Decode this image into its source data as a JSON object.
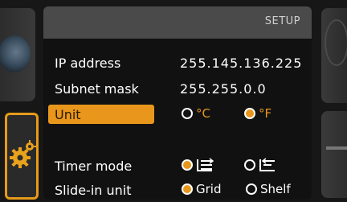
{
  "header": {
    "title": "SETUP"
  },
  "settings": {
    "ip": {
      "label": "IP address",
      "value": "255.145.136.225"
    },
    "subnet": {
      "label": "Subnet mask",
      "value": "255.255.0.0"
    },
    "unit": {
      "label": "Unit",
      "options": [
        {
          "label": "°C",
          "selected": false
        },
        {
          "label": "°F",
          "selected": true
        }
      ]
    },
    "timer": {
      "label": "Timer mode",
      "options": [
        {
          "icon": "timer-forward-icon",
          "selected": true
        },
        {
          "icon": "timer-backward-icon",
          "selected": false
        }
      ]
    },
    "slide_in": {
      "label": "Slide-in unit",
      "options": [
        {
          "label": "Grid",
          "selected": true
        },
        {
          "label": "Shelf",
          "selected": false
        }
      ]
    }
  },
  "colors": {
    "accent": "#e8961c",
    "header": "#4a4a4a",
    "panel": "#111111"
  },
  "side_icons": [
    "globe-icon",
    "settings-gears-icon"
  ]
}
